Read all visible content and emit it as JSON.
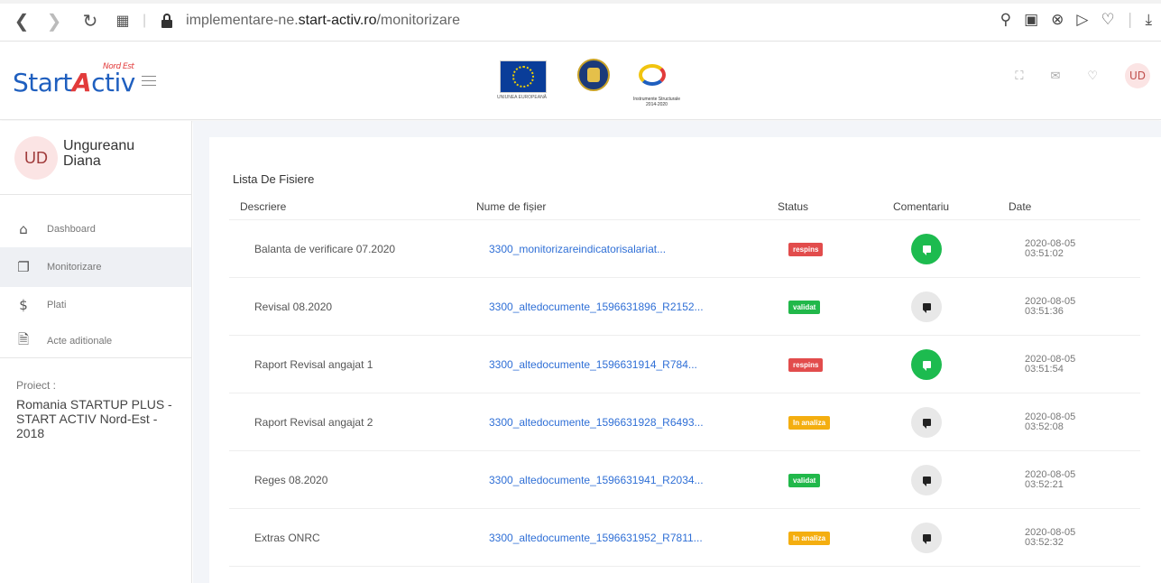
{
  "browser": {
    "url_prefix": "implementare-ne.",
    "url_host": "start-activ.ro",
    "url_path": "/monitorizare"
  },
  "header": {
    "logo_start": "Start",
    "logo_a": "A",
    "logo_ctiv": "ctiv",
    "logo_region": "Nord Est",
    "eu_caption": "UNIUNEA EUROPEANĂ",
    "struct_caption_1": "Instrumente Structurale",
    "struct_caption_2": "2014-2020",
    "avatar_initials": "UD"
  },
  "sidebar": {
    "user_initials": "UD",
    "user_name": "Ungureanu Diana",
    "menu": [
      {
        "label": "Dashboard",
        "icon": "home-icon"
      },
      {
        "label": "Monitorizare",
        "icon": "copy-icon"
      },
      {
        "label": "Plati",
        "icon": "dollar-icon"
      },
      {
        "label": "Acte aditionale",
        "icon": "file-icon"
      }
    ],
    "proiect_label": "Proiect :",
    "proiect_name": "Romania STARTUP PLUS - START ACTIV Nord-Est - 2018"
  },
  "main": {
    "title": "Lista De Fisiere",
    "columns": [
      "Descriere",
      "Nume de fișier",
      "Status",
      "Comentariu",
      "Date"
    ],
    "rows": [
      {
        "descriere": "Balanta de verificare 07.2020",
        "fisier": "3300_monitorizareindicatorisalariat...",
        "status": "respins",
        "status_type": "respins",
        "comment_active": true,
        "date": "2020-08-05",
        "time": "03:51:02"
      },
      {
        "descriere": "Revisal 08.2020",
        "fisier": "3300_altedocumente_1596631896_R2152...",
        "status": "validat",
        "status_type": "validat",
        "comment_active": false,
        "date": "2020-08-05",
        "time": "03:51:36"
      },
      {
        "descriere": "Raport Revisal angajat 1",
        "fisier": "3300_altedocumente_1596631914_R784...",
        "status": "respins",
        "status_type": "respins",
        "comment_active": true,
        "date": "2020-08-05",
        "time": "03:51:54"
      },
      {
        "descriere": "Raport Revisal angajat 2",
        "fisier": "3300_altedocumente_1596631928_R6493...",
        "status": "In analiza",
        "status_type": "analiza",
        "comment_active": false,
        "date": "2020-08-05",
        "time": "03:52:08"
      },
      {
        "descriere": "Reges 08.2020",
        "fisier": "3300_altedocumente_1596631941_R2034...",
        "status": "validat",
        "status_type": "validat",
        "comment_active": false,
        "date": "2020-08-05",
        "time": "03:52:21"
      },
      {
        "descriere": "Extras ONRC",
        "fisier": "3300_altedocumente_1596631952_R7811...",
        "status": "In analiza",
        "status_type": "analiza",
        "comment_active": false,
        "date": "2020-08-05",
        "time": "03:52:32"
      }
    ]
  },
  "colors": {
    "accent": "#2f6fd6",
    "respins": "#e24c4c",
    "validat": "#21b84a",
    "analiza": "#f4ae10",
    "comment_active": "#1dbb4f"
  }
}
